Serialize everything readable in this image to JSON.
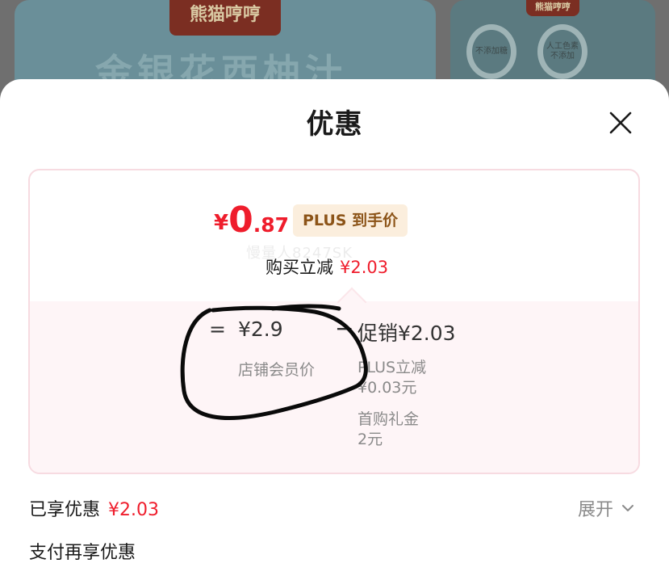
{
  "background": {
    "card1": {
      "logo": "熊猫哼哼",
      "title": "金银花西柚汁"
    },
    "card2": {
      "logo": "熊猫哼哼",
      "wreath1": "不添加糖",
      "wreath2": "人工色素 不添加"
    }
  },
  "sheet": {
    "title": "优惠",
    "close_icon": "close-icon"
  },
  "detail": {
    "price": {
      "symbol": "¥",
      "integer": "0",
      "decimal": ".87"
    },
    "plus_tag": "PLUS 到手价",
    "watermark": "慢量人8247SK",
    "reduce_label": "购买立减",
    "reduce_amount": "¥2.03",
    "equals": "=",
    "shop_price": "¥2.9",
    "shop_price_label": "店铺会员价",
    "minus": "−",
    "promo": "促销¥2.03",
    "sub_items": [
      {
        "name": "PLUS立减",
        "value": "¥0.03元"
      },
      {
        "name": "首购礼金",
        "value": "2元"
      }
    ]
  },
  "summary": {
    "enjoyed_label": "已享优惠",
    "enjoyed_amount": "¥2.03",
    "expand_label": "展开",
    "pay_more_label": "支付再享优惠"
  },
  "colors": {
    "accent_red": "#ef1d2c",
    "plus_tag_bg": "#fbeedd",
    "plus_tag_text": "#8c5418",
    "card_border": "#f7dbe1",
    "card_tint": "#fef5f7"
  }
}
